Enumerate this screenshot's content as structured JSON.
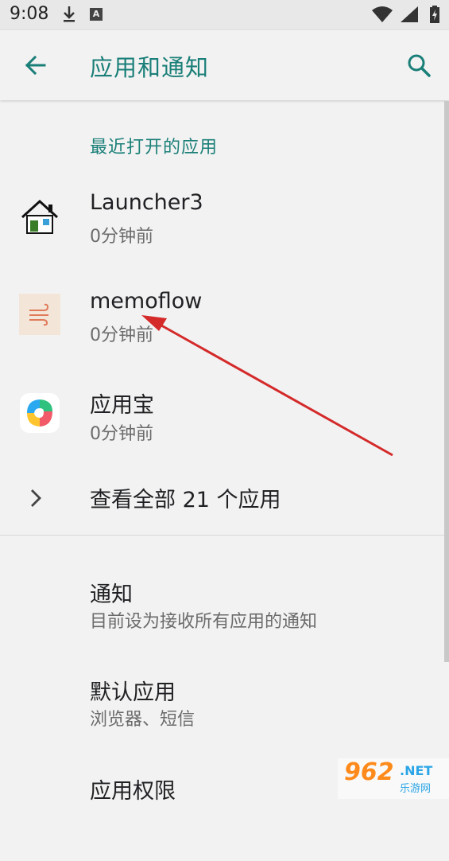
{
  "status_bar": {
    "time": "9:08",
    "badge": "A"
  },
  "app_bar": {
    "title": "应用和通知",
    "back_icon": "arrow-left-icon",
    "search_icon": "search-icon"
  },
  "recent": {
    "header": "最近打开的应用",
    "apps": [
      {
        "name": "Launcher3",
        "time": "0分钟前",
        "icon": "house-icon"
      },
      {
        "name": "memoflow",
        "time": "0分钟前",
        "icon": "wind-icon"
      },
      {
        "name": "应用宝",
        "time": "0分钟前",
        "icon": "yingyongbao-icon"
      }
    ],
    "see_all": "查看全部 21 个应用"
  },
  "prefs": [
    {
      "title": "通知",
      "subtitle": "目前设为接收所有应用的通知"
    },
    {
      "title": "默认应用",
      "subtitle": "浏览器、短信"
    },
    {
      "title": "应用权限",
      "subtitle": ""
    }
  ],
  "watermark": {
    "main": "962",
    "net": ".NET",
    "sub": "乐游网"
  },
  "colors": {
    "accent": "#1a7f78",
    "background": "#f2f2f2",
    "annotation_arrow": "#d42a2a"
  }
}
